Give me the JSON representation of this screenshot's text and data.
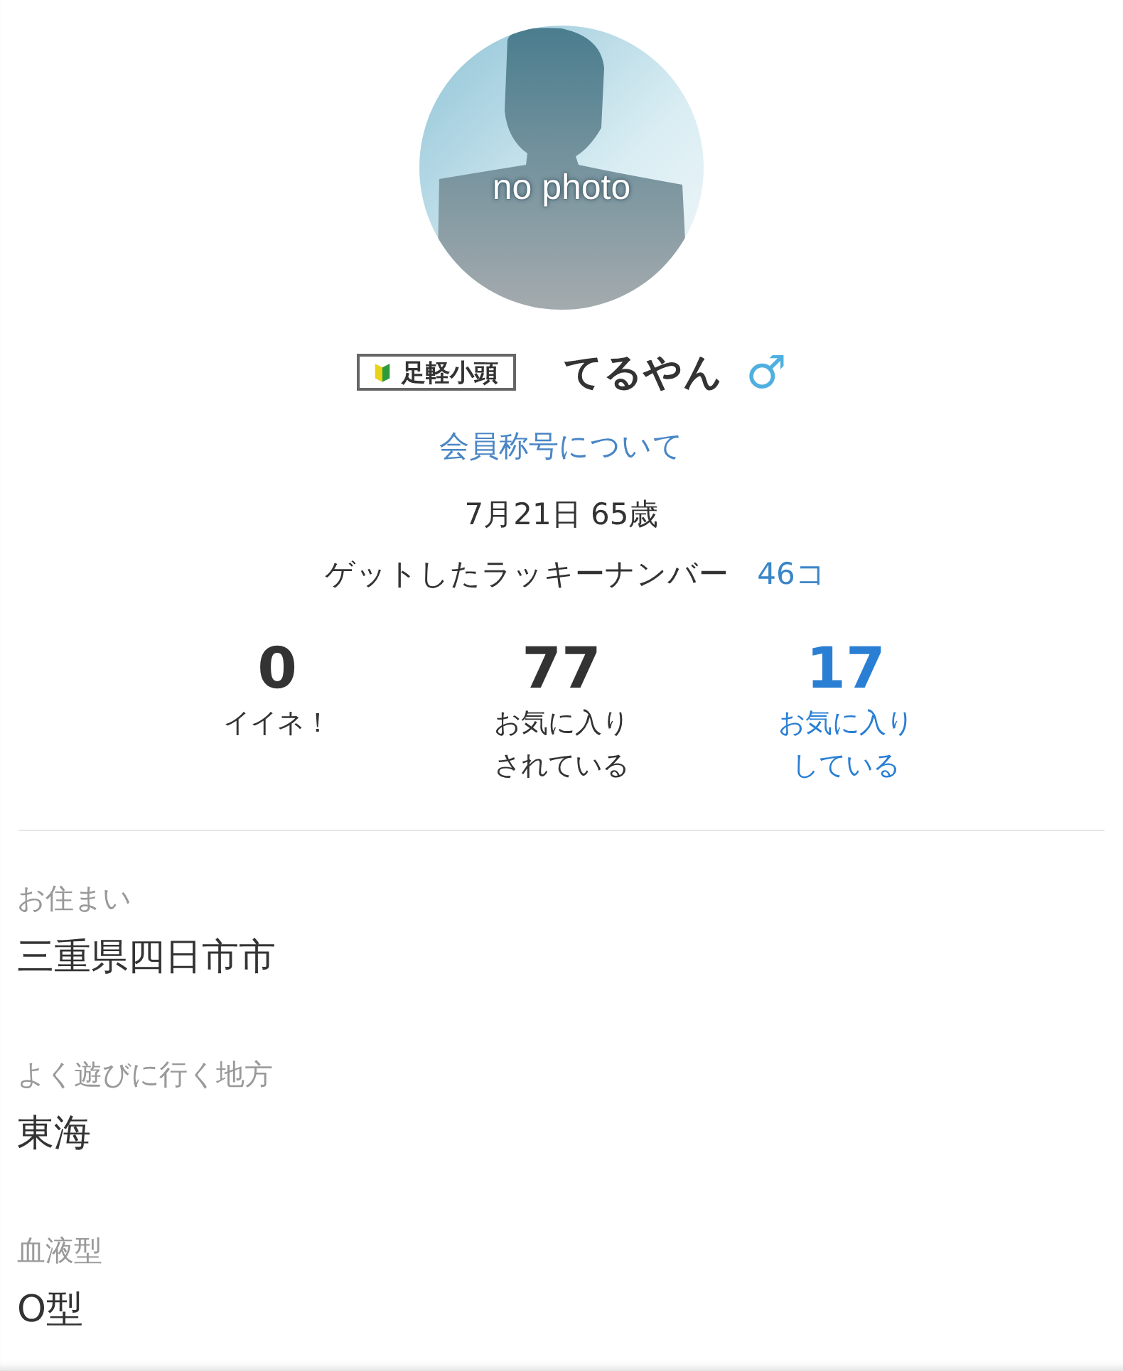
{
  "avatar": {
    "caption": "no photo"
  },
  "title_badge": {
    "label": "足軽小頭"
  },
  "name": "てるやん",
  "gender_symbol": "♂",
  "title_link": "会員称号について",
  "birthday": "7月21日 65歳",
  "lucky": {
    "label": "ゲットしたラッキーナンバー",
    "count": "46コ"
  },
  "stats": [
    {
      "value": "0",
      "label_lines": [
        "イイネ！"
      ],
      "kind": "count"
    },
    {
      "value": "77",
      "label_lines": [
        "お気に入り",
        "されている"
      ],
      "kind": "count"
    },
    {
      "value": "17",
      "label_lines": [
        "お気に入り",
        "している"
      ],
      "kind": "link"
    }
  ],
  "fields": [
    {
      "label": "お住まい",
      "value": "三重県四日市市"
    },
    {
      "label": "よく遊びに行く地方",
      "value": "東海"
    },
    {
      "label": "血液型",
      "value": "O型"
    }
  ]
}
